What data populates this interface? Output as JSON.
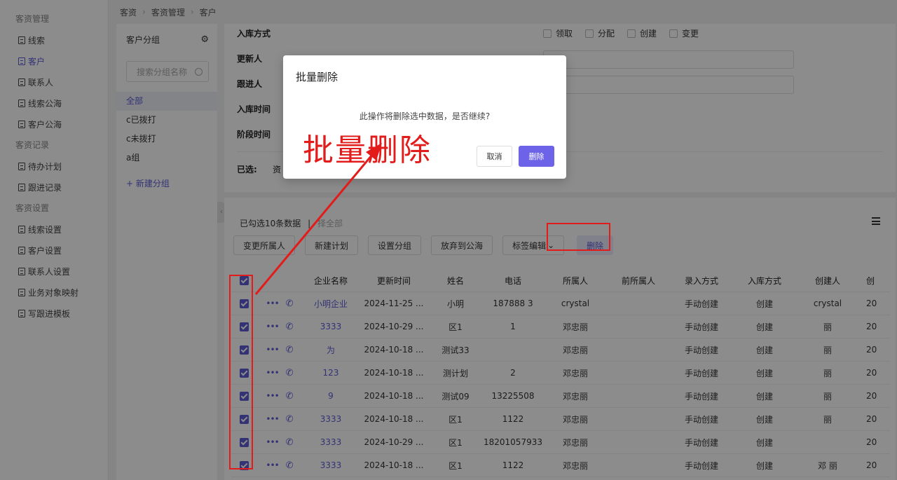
{
  "sidebar": {
    "sections": [
      {
        "title": "客资管理",
        "items": [
          {
            "label": "线索",
            "active": false
          },
          {
            "label": "客户",
            "active": true
          },
          {
            "label": "联系人",
            "active": false
          },
          {
            "label": "线索公海",
            "active": false
          },
          {
            "label": "客户公海",
            "active": false
          }
        ]
      },
      {
        "title": "客资记录",
        "items": [
          {
            "label": "待办计划",
            "active": false
          },
          {
            "label": "跟进记录",
            "active": false
          }
        ]
      },
      {
        "title": "客资设置",
        "items": [
          {
            "label": "线索设置",
            "active": false
          },
          {
            "label": "客户设置",
            "active": false
          },
          {
            "label": "联系人设置",
            "active": false
          },
          {
            "label": "业务对象映射",
            "active": false
          },
          {
            "label": "写跟进模板",
            "active": false
          }
        ]
      }
    ]
  },
  "breadcrumb": [
    "客资",
    "客资管理",
    "客户"
  ],
  "groups": {
    "title": "客户分组",
    "search_placeholder": "搜索分组名称",
    "items": [
      {
        "label": "全部",
        "active": true
      },
      {
        "label": "c已拨打",
        "active": false
      },
      {
        "label": "c未拨打",
        "active": false
      },
      {
        "label": "a组",
        "active": false
      }
    ],
    "add_label": "+ 新建分组"
  },
  "filters": {
    "stock_method_label": "入库方式",
    "stock_options": [
      "领取",
      "分配",
      "创建",
      "变更"
    ],
    "updater_label": "更新人",
    "follower_label": "跟进人",
    "stock_time_label": "入库时间",
    "stage_time_label": "阶段时间",
    "selected_label": "已选:",
    "selected_value": "资"
  },
  "table_area": {
    "selection_info": "已勾选10条数据",
    "select_all": "择全部",
    "buttons": [
      "变更所属人",
      "新建计划",
      "设置分组",
      "放弃到公海",
      "标签编辑"
    ],
    "delete_button": "删除",
    "columns": [
      "企业名称",
      "更新时间",
      "姓名",
      "电话",
      "所属人",
      "前所属人",
      "录入方式",
      "入库方式",
      "创建人",
      "创"
    ],
    "rows": [
      {
        "company": "小明企业",
        "time": "2024-11-25 ...",
        "name": "小明",
        "phone": "187888 3",
        "owner": "crystal",
        "prev": "",
        "entry": "手动创建",
        "stock": "创建",
        "creator": "crystal",
        "extra": "20"
      },
      {
        "company": "3333",
        "time": "2024-10-29 ...",
        "name": "区1",
        "phone": "1",
        "owner": "邓忠丽",
        "prev": "",
        "entry": "手动创建",
        "stock": "创建",
        "creator": "丽",
        "extra": "20"
      },
      {
        "company": "为",
        "time": "2024-10-18 ...",
        "name": "测试33",
        "phone": "",
        "owner": "邓忠丽",
        "prev": "",
        "entry": "手动创建",
        "stock": "创建",
        "creator": "丽",
        "extra": "20"
      },
      {
        "company": "123",
        "time": "2024-10-18 ...",
        "name": "测计划",
        "phone": "2",
        "owner": "邓忠丽",
        "prev": "",
        "entry": "手动创建",
        "stock": "创建",
        "creator": "丽",
        "extra": "20"
      },
      {
        "company": "9",
        "time": "2024-10-18 ...",
        "name": "测试09",
        "phone": "13225508",
        "owner": "邓忠丽",
        "prev": "",
        "entry": "手动创建",
        "stock": "创建",
        "creator": "丽",
        "extra": "20"
      },
      {
        "company": "3333",
        "time": "2024-10-18 ...",
        "name": "区1",
        "phone": "1122",
        "owner": "邓忠丽",
        "prev": "",
        "entry": "手动创建",
        "stock": "创建",
        "creator": "丽",
        "extra": "20"
      },
      {
        "company": "3333",
        "time": "2024-10-29 ...",
        "name": "区1",
        "phone": "18201057933",
        "owner": "邓忠丽",
        "prev": "",
        "entry": "手动创建",
        "stock": "创建",
        "creator": "",
        "extra": "20"
      },
      {
        "company": "3333",
        "time": "2024-10-18 ...",
        "name": "区1",
        "phone": "1122",
        "owner": "邓忠丽",
        "prev": "",
        "entry": "手动创建",
        "stock": "创建",
        "creator": "邓 丽",
        "extra": "20"
      }
    ]
  },
  "modal": {
    "title": "批量删除",
    "message": "此操作将删除选中数据，是否继续?",
    "cancel": "取消",
    "confirm": "删除"
  },
  "annotation": {
    "text": "批量删除",
    "color": "#e21b1b"
  },
  "colors": {
    "accent": "#5b5bd6",
    "confirm_button": "#6c63e8"
  }
}
